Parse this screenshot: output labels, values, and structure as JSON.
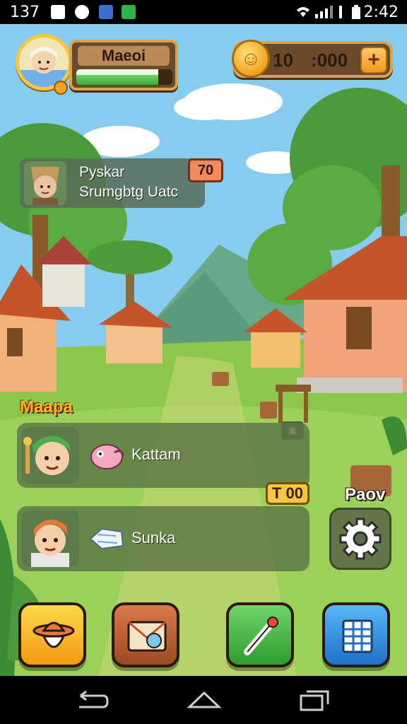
{
  "status_bar": {
    "time_left": "137",
    "time_right": "2:42"
  },
  "player": {
    "name": "Maeoi",
    "xp_fraction": 0.85
  },
  "currency": {
    "coins_primary": "10",
    "coins_secondary": ":000",
    "add_label": "+"
  },
  "quest": {
    "title": "Pyskar",
    "subtitle": "Srumgbtg Uatc",
    "badge": "70"
  },
  "section": {
    "label": "Maapa",
    "tag": "▣"
  },
  "list": {
    "items": [
      {
        "label": "Kattam",
        "icon": "crab-icon"
      },
      {
        "label": "Sunka",
        "icon": "fish-icon"
      }
    ],
    "cost_badge": "T 00",
    "side_label": "Paov"
  },
  "dock": {
    "buttons": [
      {
        "icon": "cowboy-hat-icon",
        "color": "#f39a12"
      },
      {
        "icon": "map-icon",
        "color": "#9c4a22"
      },
      {
        "icon": "brush-icon",
        "color": "#2f9c2f"
      },
      {
        "icon": "grid-icon",
        "color": "#1f6fc8"
      }
    ]
  },
  "colors": {
    "accent_gold": "#f6c542",
    "panel_brown": "#6b4a2c",
    "grass": "#8cc64a"
  }
}
